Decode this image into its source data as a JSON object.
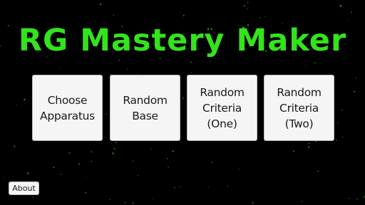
{
  "title": "RG Mastery Maker",
  "colors": {
    "background": "#000000",
    "title": "#33e31c",
    "stars": "#2fd21a",
    "button_face": "#f5f5f5",
    "button_text": "#1a1a1a"
  },
  "buttons": [
    {
      "label": "Choose\nApparatus"
    },
    {
      "label": "Random\nBase"
    },
    {
      "label": "Random\nCriteria\n(One)"
    },
    {
      "label": "Random\nCriteria\n(Two)"
    }
  ],
  "about_label": "About"
}
